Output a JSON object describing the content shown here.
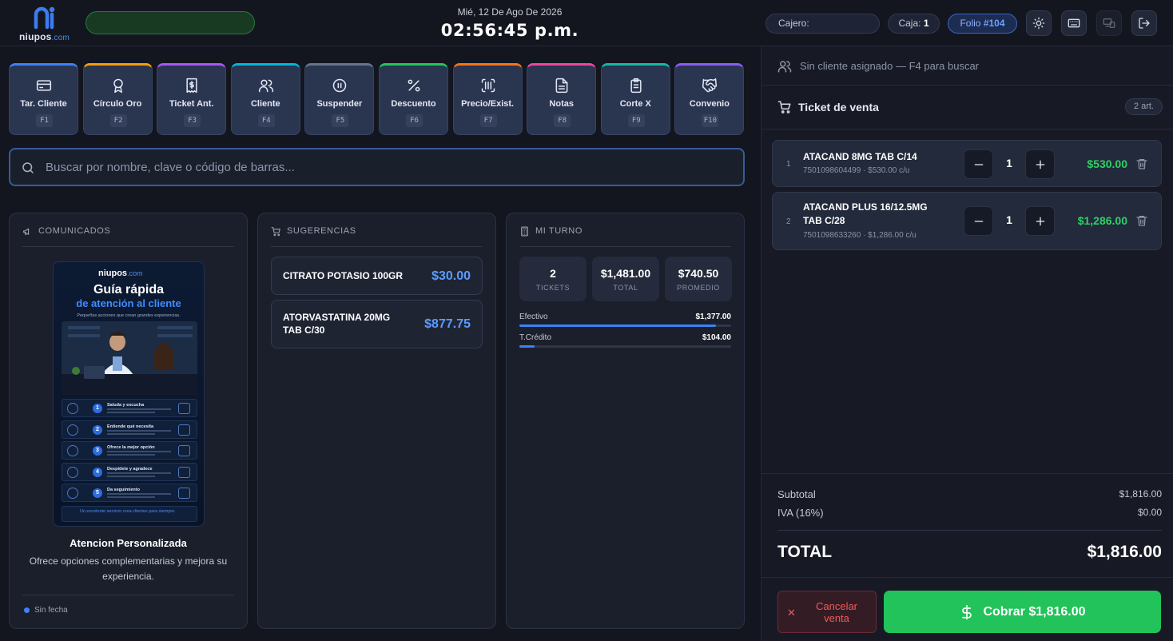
{
  "header": {
    "logo_text": "niupos",
    "logo_domain": ".com",
    "date": "Mié, 12 De Ago De 2026",
    "time": "02:56:45 p.m.",
    "cashier_label": "Cajero:",
    "box_label": "Caja:",
    "box_value": "1",
    "folio_label": "Folio",
    "folio_value": "#104",
    "status_color": "#183a23"
  },
  "function_keys": [
    {
      "label": "Tar. Cliente",
      "key": "F1",
      "icon": "card-icon",
      "accent": "#3b82f6"
    },
    {
      "label": "Círculo Oro",
      "key": "F2",
      "icon": "award-icon",
      "accent": "#f59e0b"
    },
    {
      "label": "Ticket Ant.",
      "key": "F3",
      "icon": "receipt-icon",
      "accent": "#a855f7"
    },
    {
      "label": "Cliente",
      "key": "F4",
      "icon": "users-icon",
      "accent": "#06b6d4"
    },
    {
      "label": "Suspender",
      "key": "F5",
      "icon": "pause-icon",
      "accent": "#64748b"
    },
    {
      "label": "Descuento",
      "key": "F6",
      "icon": "percent-icon",
      "accent": "#22c55e"
    },
    {
      "label": "Precio/Exist.",
      "key": "F7",
      "icon": "barcode-scan-icon",
      "accent": "#f97316"
    },
    {
      "label": "Notas",
      "key": "F8",
      "icon": "document-icon",
      "accent": "#ec4899"
    },
    {
      "label": "Corte X",
      "key": "F9",
      "icon": "clipboard-icon",
      "accent": "#14b8a6"
    },
    {
      "label": "Convenio",
      "key": "F10",
      "icon": "handshake-icon",
      "accent": "#8b5cf6"
    }
  ],
  "search": {
    "placeholder": "Buscar por nombre, clave o código de barras..."
  },
  "announcements": {
    "header": "COMUNICADOS",
    "poster": {
      "logo": "niupos",
      "logo_domain": ".com",
      "title_line1": "Guía rápida",
      "title_line2": "de atención al cliente",
      "subtitle": "Pequeñas acciones que crean grandes experiencias.",
      "steps": [
        {
          "num": "1",
          "title": "Saluda y escucha"
        },
        {
          "num": "2",
          "title": "Entiende qué necesita"
        },
        {
          "num": "3",
          "title": "Ofrece la mejor opción"
        },
        {
          "num": "4",
          "title": "Despídete y agradece"
        },
        {
          "num": "5",
          "title": "Da seguimiento"
        }
      ],
      "footer": "Un excelente servicio crea clientes para siempre."
    },
    "title": "Atencion Personalizada",
    "description": "Ofrece opciones complementarias y mejora su experiencia.",
    "date": "Sin fecha"
  },
  "suggestions": {
    "header": "SUGERENCIAS",
    "items": [
      {
        "name": "CITRATO POTASIO 100GR",
        "price": "$30.00"
      },
      {
        "name": "ATORVASTATINA 20MG TAB C/30",
        "price": "$877.75"
      }
    ]
  },
  "shift": {
    "header": "MI TURNO",
    "stats": [
      {
        "value": "2",
        "label": "TICKETS"
      },
      {
        "value": "$1,481.00",
        "label": "TOTAL"
      },
      {
        "value": "$740.50",
        "label": "PROMEDIO"
      }
    ],
    "payments": [
      {
        "name": "Efectivo",
        "amount": "$1,377.00",
        "fraction": 0.93
      },
      {
        "name": "T.Crédito",
        "amount": "$104.00",
        "fraction": 0.07
      }
    ]
  },
  "ticket": {
    "client_text": "Sin cliente asignado — F4 para buscar",
    "title": "Ticket de venta",
    "count": "2 art.",
    "items": [
      {
        "num": "1",
        "name": "ATACAND 8MG TAB C/14",
        "detail": "7501098604499 · $530.00 c/u",
        "qty": "1",
        "total": "$530.00"
      },
      {
        "num": "2",
        "name": "ATACAND PLUS 16/12.5MG TAB C/28",
        "detail": "7501098633260 · $1,286.00 c/u",
        "qty": "1",
        "total": "$1,286.00"
      }
    ],
    "subtotal_label": "Subtotal",
    "subtotal": "$1,816.00",
    "tax_label": "IVA (16%)",
    "tax": "$0.00",
    "total_label": "TOTAL",
    "total": "$1,816.00",
    "cancel_label": "Cancelar venta",
    "pay_label": "Cobrar $1,816.00"
  }
}
